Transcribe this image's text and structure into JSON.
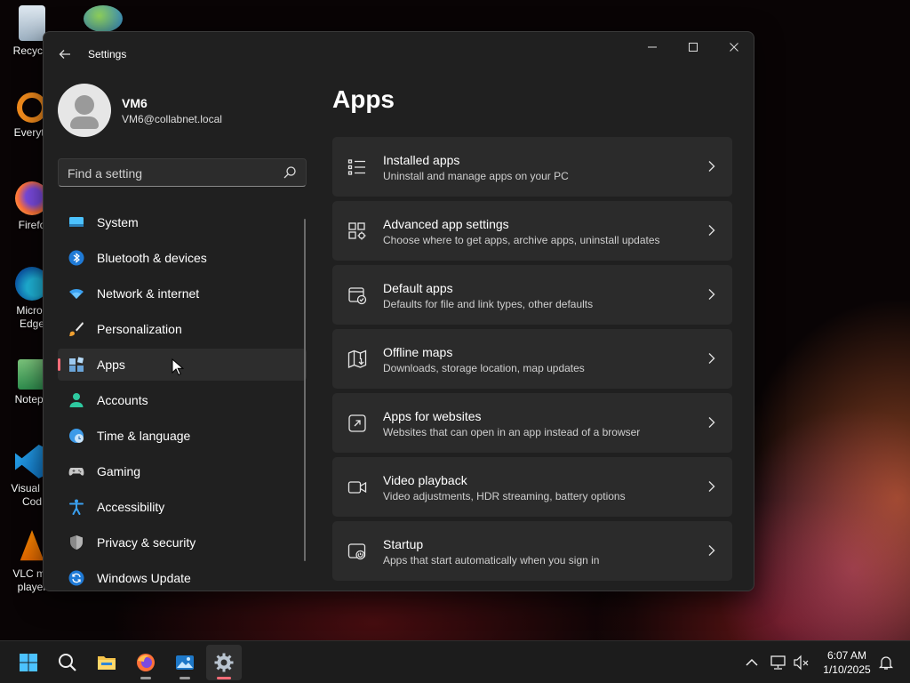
{
  "desktop": {
    "icons": [
      {
        "label_line1": "Recycle",
        "label_line2": ""
      },
      {
        "label_line1": "Everyth",
        "label_line2": ""
      },
      {
        "label_line1": "Firefo",
        "label_line2": ""
      },
      {
        "label_line1": "Micros",
        "label_line2": "Edge"
      },
      {
        "label_line1": "Notepa",
        "label_line2": ""
      },
      {
        "label_line1": "Visual St",
        "label_line2": "Cod"
      },
      {
        "label_line1": "VLC me",
        "label_line2": "player"
      }
    ]
  },
  "window": {
    "title": "Settings",
    "controls": {
      "minimize": "—",
      "maximize": "☐",
      "close": "✕"
    }
  },
  "profile": {
    "name": "VM6",
    "email": "VM6@collabnet.local"
  },
  "search": {
    "placeholder": "Find a setting",
    "value": ""
  },
  "nav": {
    "items": [
      {
        "label": "System",
        "icon": "system-icon"
      },
      {
        "label": "Bluetooth & devices",
        "icon": "bluetooth-icon"
      },
      {
        "label": "Network & internet",
        "icon": "wifi-icon"
      },
      {
        "label": "Personalization",
        "icon": "brush-icon"
      },
      {
        "label": "Apps",
        "icon": "apps-icon",
        "active": true
      },
      {
        "label": "Accounts",
        "icon": "accounts-icon"
      },
      {
        "label": "Time & language",
        "icon": "globe-icon"
      },
      {
        "label": "Gaming",
        "icon": "gamepad-icon"
      },
      {
        "label": "Accessibility",
        "icon": "accessibility-icon"
      },
      {
        "label": "Privacy & security",
        "icon": "shield-icon"
      },
      {
        "label": "Windows Update",
        "icon": "update-icon"
      }
    ]
  },
  "main": {
    "title": "Apps",
    "cards": [
      {
        "title": "Installed apps",
        "subtitle": "Uninstall and manage apps on your PC",
        "icon": "list-icon"
      },
      {
        "title": "Advanced app settings",
        "subtitle": "Choose where to get apps, archive apps, uninstall updates",
        "icon": "app-settings-icon"
      },
      {
        "title": "Default apps",
        "subtitle": "Defaults for file and link types, other defaults",
        "icon": "default-apps-icon"
      },
      {
        "title": "Offline maps",
        "subtitle": "Downloads, storage location, map updates",
        "icon": "map-icon"
      },
      {
        "title": "Apps for websites",
        "subtitle": "Websites that can open in an app instead of a browser",
        "icon": "open-external-icon"
      },
      {
        "title": "Video playback",
        "subtitle": "Video adjustments, HDR streaming, battery options",
        "icon": "video-icon"
      },
      {
        "title": "Startup",
        "subtitle": "Apps that start automatically when you sign in",
        "icon": "startup-icon"
      }
    ]
  },
  "taskbar": {
    "apps": [
      "start-icon",
      "search-icon",
      "file-explorer-icon",
      "firefox-icon",
      "photos-icon",
      "settings-icon"
    ],
    "clock": {
      "time": "6:07 AM",
      "date": "1/10/2025"
    }
  },
  "colors": {
    "accent": "#ff6c78",
    "window_bg": "#202020",
    "card_bg": "#2b2b2b"
  }
}
